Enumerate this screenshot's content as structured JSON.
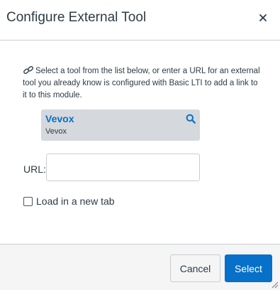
{
  "dialog": {
    "title": "Configure External Tool",
    "close_label": "×"
  },
  "intro": {
    "text": "Select a tool from the list below, or enter a URL for an external tool you already know is configured with Basic LTI to add a link to it to this module.",
    "icon": "link-icon"
  },
  "tool": {
    "name": "Vevox",
    "subtitle": "Vevox",
    "icon": "search-icon"
  },
  "url": {
    "label": "URL:",
    "value": "",
    "placeholder": ""
  },
  "new_tab": {
    "label": "Load in a new tab",
    "checked": false
  },
  "footer": {
    "cancel_label": "Cancel",
    "select_label": "Select"
  },
  "colors": {
    "primary": "#0770c9",
    "text": "#2d3b45",
    "card_bg": "#d5d8dc",
    "footer_bg": "#f5f5f5"
  }
}
